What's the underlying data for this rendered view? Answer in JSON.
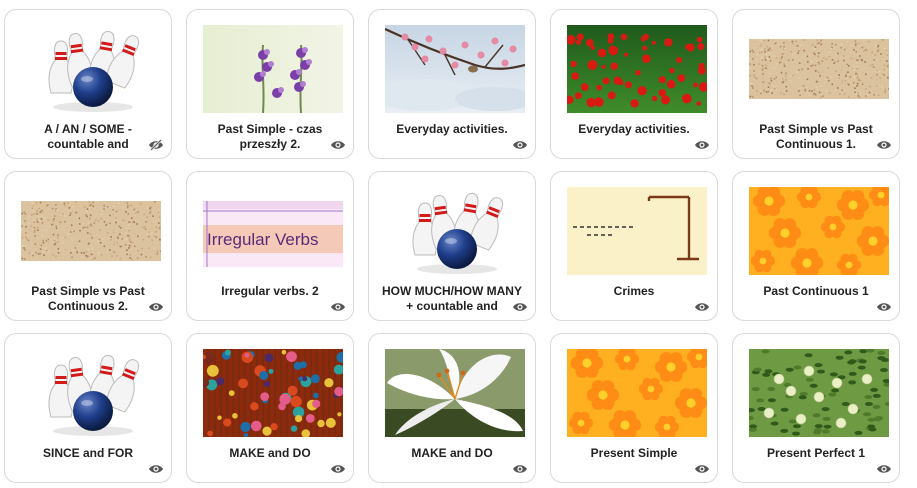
{
  "cards": [
    {
      "title": "A / AN / SOME - countable and",
      "thumb": "bowling",
      "icon": "eye-slash-icon"
    },
    {
      "title": "Past Simple - czas przeszły 2.",
      "thumb": "purple-flowers",
      "icon": "eye-icon"
    },
    {
      "title": "Everyday activities.",
      "thumb": "blossom-bird",
      "icon": "eye-icon"
    },
    {
      "title": "Everyday activities.",
      "thumb": "poppies",
      "icon": "eye-icon"
    },
    {
      "title": "Past Simple vs Past Continuous 1.",
      "thumb": "sand",
      "icon": "eye-icon"
    },
    {
      "title": "Past Simple vs Past Continuous 2.",
      "thumb": "sand",
      "icon": "eye-icon"
    },
    {
      "title": "Irregular verbs. 2",
      "thumb": "irregular-verbs",
      "icon": "eye-icon",
      "thumb_text": "Irregular Verbs"
    },
    {
      "title": "HOW MUCH/HOW MANY + countable and",
      "thumb": "bowling",
      "icon": "eye-icon"
    },
    {
      "title": "Crimes",
      "thumb": "hangman",
      "icon": "eye-icon"
    },
    {
      "title": "Past Continuous 1",
      "thumb": "orange-flowers",
      "icon": "eye-icon"
    },
    {
      "title": "SINCE and FOR",
      "thumb": "bowling",
      "icon": "eye-icon"
    },
    {
      "title": "MAKE and DO",
      "thumb": "beads",
      "icon": "eye-icon"
    },
    {
      "title": "MAKE and DO",
      "thumb": "lily",
      "icon": "eye-icon"
    },
    {
      "title": "Present Simple",
      "thumb": "orange-flowers",
      "icon": "eye-icon"
    },
    {
      "title": "Present Perfect 1",
      "thumb": "apple-tree",
      "icon": "eye-icon"
    }
  ]
}
